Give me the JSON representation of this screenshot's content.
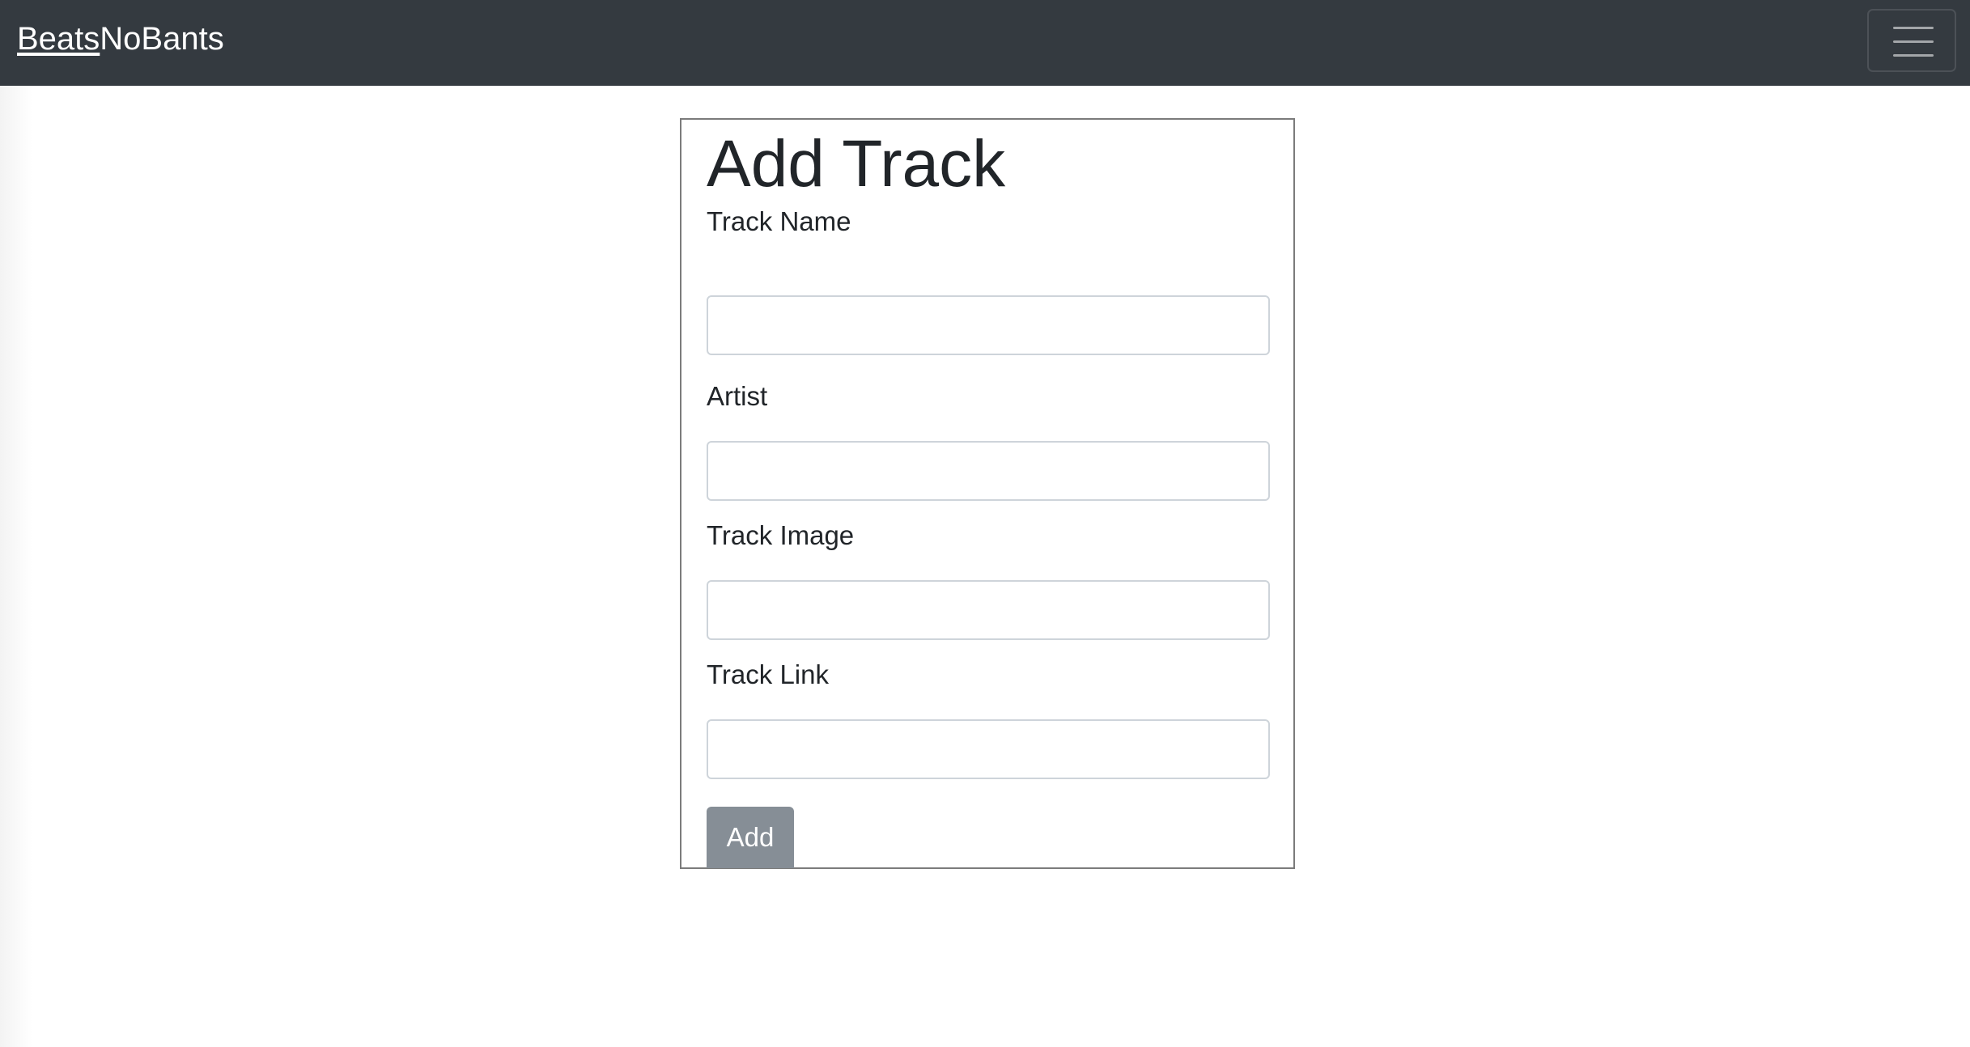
{
  "navbar": {
    "brand_part1": "Beats",
    "brand_part2": "NoBants",
    "menu_icon": "hamburger-menu-icon"
  },
  "form": {
    "title": "Add Track",
    "fields": [
      {
        "label": "Track Name",
        "value": "",
        "placeholder": ""
      },
      {
        "label": "Artist",
        "value": "",
        "placeholder": ""
      },
      {
        "label": "Track Image",
        "value": "",
        "placeholder": ""
      },
      {
        "label": "Track Link",
        "value": "",
        "placeholder": ""
      }
    ],
    "submit_label": "Add"
  },
  "colors": {
    "navbar_bg": "#343a40",
    "button_bg": "#868e96",
    "text": "#212529",
    "input_border": "#ced4da"
  }
}
